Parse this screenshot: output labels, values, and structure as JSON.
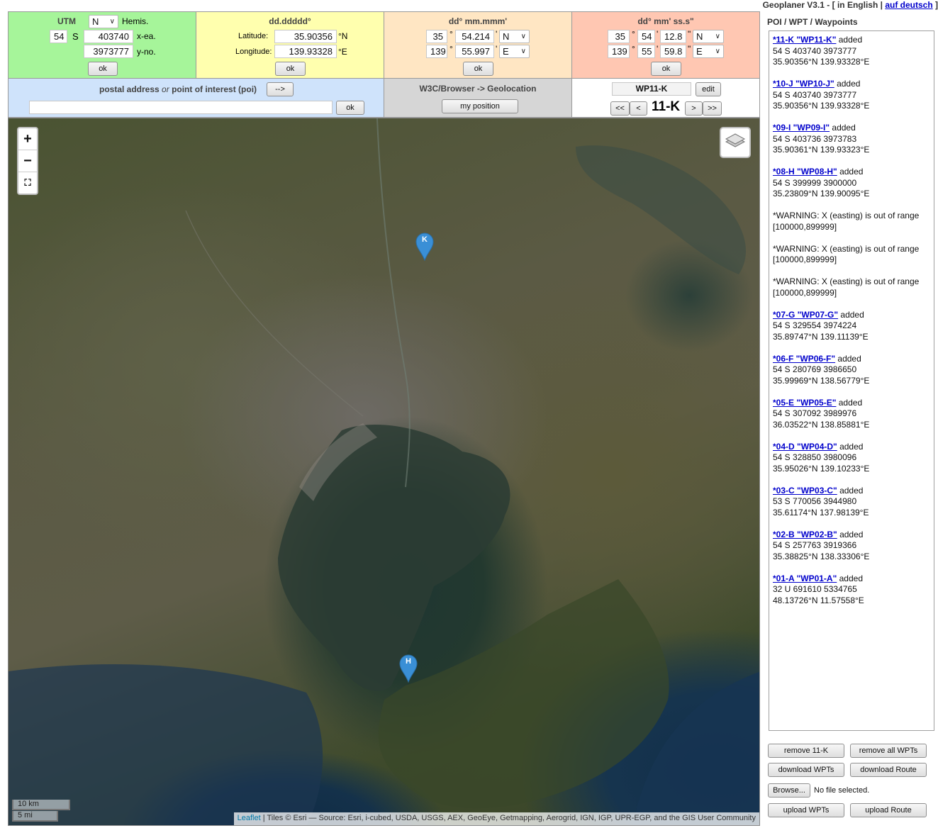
{
  "header": {
    "app_version": "Geoplaner V3.1 - [",
    "lang_current": " in English |",
    "lang_link": "auf deutsch",
    "lang_close": " ]"
  },
  "utm": {
    "title": "UTM",
    "hemis_select": "N",
    "hemis_label": "Hemis.",
    "zone": "54",
    "band": "S",
    "easting": "403740",
    "easting_label": "x-ea.",
    "northing": "3973777",
    "northing_label": "y-no.",
    "ok": "ok"
  },
  "dd": {
    "title": "dd.ddddd°",
    "lat_label": "Latitude:",
    "lat_value": "35.90356",
    "lat_unit": "°N",
    "lon_label": "Longitude:",
    "lon_value": "139.93328",
    "lon_unit": "°E",
    "ok": "ok"
  },
  "dm": {
    "title": "dd° mm.mmm'",
    "lat_deg": "35",
    "lat_min": "54.214",
    "lat_hem": "N",
    "lon_deg": "139",
    "lon_min": "55.997",
    "lon_hem": "E",
    "deg_sym": "°",
    "min_sym": "'",
    "ok": "ok"
  },
  "dms": {
    "title": "dd° mm' ss.s\"",
    "lat_deg": "35",
    "lat_min": "54",
    "lat_sec": "12.8",
    "lat_hem": "N",
    "lon_deg": "139",
    "lon_min": "55",
    "lon_sec": "59.8",
    "lon_hem": "E",
    "deg_sym": "°",
    "min_sym": "'",
    "sec_sym": "\"",
    "ok": "ok"
  },
  "address": {
    "title_a": "postal address",
    "title_or": "or",
    "title_b": "point of interest (poi)",
    "arrow_button": "-->",
    "input_value": "",
    "ok": "ok"
  },
  "geoloc": {
    "title": "W3C/Browser -> Geolocation",
    "my_position": "my position"
  },
  "waypoint_nav": {
    "name_value": "WP11-K",
    "edit": "edit",
    "first": "<<",
    "prev": "<",
    "current": "11-K",
    "next": ">",
    "last": ">>"
  },
  "map": {
    "zoom_in": "+",
    "zoom_out": "−",
    "markers": [
      {
        "label": "K"
      },
      {
        "label": "H"
      }
    ],
    "scale_km": "10 km",
    "scale_mi": "5 mi",
    "attribution_link": "Leaflet",
    "attribution_text": " | Tiles © Esri — Source: Esri, i-cubed, USDA, USGS, AEX, GeoEye, Getmapping, Aerogrid, IGN, IGP, UPR-EGP, and the GIS User Community",
    "marker_color": "#3a8fd6"
  },
  "sidebar": {
    "title": "POI / WPT / Waypoints",
    "entries": [
      {
        "link": "*11-K \"WP11-K\"",
        "suffix": " added",
        "line2": "54 S 403740 3973777",
        "line3": "35.90356°N 139.93328°E"
      },
      {
        "link": "*10-J \"WP10-J\"",
        "suffix": " added",
        "line2": "54 S 403740 3973777",
        "line3": "35.90356°N 139.93328°E"
      },
      {
        "link": "*09-I \"WP09-I\"",
        "suffix": " added",
        "line2": "54 S 403736 3973783",
        "line3": "35.90361°N 139.93323°E"
      },
      {
        "link": "*08-H \"WP08-H\"",
        "suffix": " added",
        "line2": "54 S 399999 3900000",
        "line3": "35.23809°N 139.90095°E"
      },
      {
        "warning": "*WARNING: X (easting) is out of range [100000,899999]"
      },
      {
        "warning": "*WARNING: X (easting) is out of range [100000,899999]"
      },
      {
        "warning": "*WARNING: X (easting) is out of range [100000,899999]"
      },
      {
        "link": "*07-G \"WP07-G\"",
        "suffix": " added",
        "line2": "54 S 329554 3974224",
        "line3": "35.89747°N 139.11139°E"
      },
      {
        "link": "*06-F \"WP06-F\"",
        "suffix": " added",
        "line2": "54 S 280769 3986650",
        "line3": "35.99969°N 138.56779°E"
      },
      {
        "link": "*05-E \"WP05-E\"",
        "suffix": " added",
        "line2": "54 S 307092 3989976",
        "line3": "36.03522°N 138.85881°E"
      },
      {
        "link": "*04-D \"WP04-D\"",
        "suffix": " added",
        "line2": "54 S 328850 3980096",
        "line3": "35.95026°N 139.10233°E"
      },
      {
        "link": "*03-C \"WP03-C\"",
        "suffix": " added",
        "line2": "53 S 770056 3944980",
        "line3": "35.61174°N 137.98139°E"
      },
      {
        "link": "*02-B \"WP02-B\"",
        "suffix": " added",
        "line2": "54 S 257763 3919366",
        "line3": "35.38825°N 138.33306°E"
      },
      {
        "link": "*01-A \"WP01-A\"",
        "suffix": " added",
        "line2": "32 U 691610 5334765",
        "line3": "48.13726°N 11.57558°E"
      }
    ],
    "remove_one": "remove 11-K",
    "remove_all": "remove all WPTs",
    "download_wpts": "download WPTs",
    "download_route": "download Route",
    "browse": "Browse...",
    "no_file": "No file selected.",
    "upload_wpts": "upload WPTs",
    "upload_route": "upload Route"
  },
  "colors": {
    "utm_bg": "#a6f59a",
    "dd_bg": "#ffffae",
    "dm_bg": "#ffe6c3",
    "dms_bg": "#ffc7b2",
    "address_bg": "#cfe3fb",
    "geoloc_bg": "#d6d6d6",
    "nav_bg": "#ffffff"
  }
}
